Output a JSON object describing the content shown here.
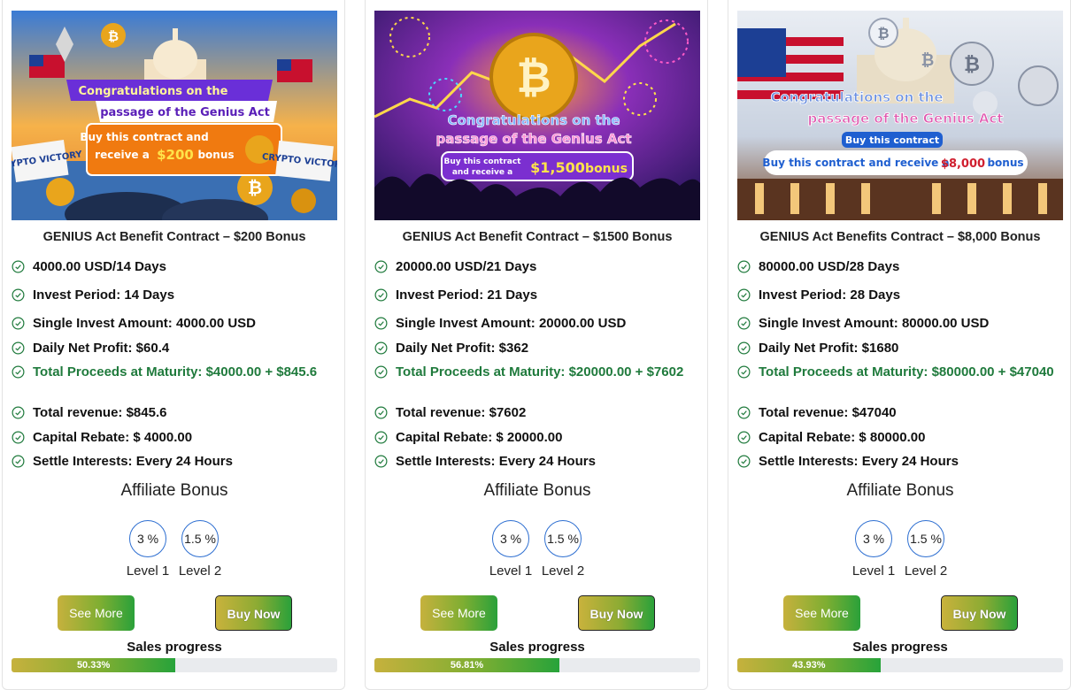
{
  "contracts": [
    {
      "banner": {
        "headline_1": "Congratulations on the",
        "headline_2": "passage  of the Genius Act",
        "offer_1": "Buy this contract and",
        "offer_2": "receive a",
        "bonus": "$200",
        "bonus_word": "bonus",
        "sign_left": "CRYPTO VICTORY",
        "sign_right": "CRYPTO VICTORY",
        "colors": {
          "sky": "#f6b24a",
          "headline_bg": "#6a2fd8",
          "offer_bg": "#f07a10"
        }
      },
      "title": "GENIUS Act Benefit Contract – $200 Bonus",
      "features": [
        "4000.00 USD/14 Days",
        "Invest Period: 14 Days",
        "Single Invest Amount: 4000.00 USD",
        "Daily Net Profit: $60.4",
        "Total Proceeds at Maturity: $4000.00 + $845.6",
        "Total revenue: $845.6",
        "Capital Rebate: $ 4000.00",
        "Settle Interests: Every 24 Hours"
      ],
      "affiliate_title": "Affiliate Bonus",
      "levels": [
        {
          "rate": "3 %",
          "label": "Level 1"
        },
        {
          "rate": "1.5 %",
          "label": "Level 2"
        }
      ],
      "see_more": "See More",
      "buy_now": "Buy Now",
      "sales_label": "Sales progress",
      "progress_text": "50.33%",
      "progress": 50.33
    },
    {
      "banner": {
        "headline_1": "Congratulations on the",
        "headline_2": "passage of the Genius Act",
        "offer_1": "Buy this contract",
        "offer_2": "and receive a",
        "bonus": "$1,500",
        "bonus_word": "bonus",
        "colors": {
          "sky": "#2b1c6b",
          "headline_bg": "#4a2fc4",
          "offer_bg": "#7b2fd0"
        }
      },
      "title": "GENIUS Act Benefit Contract – $1500 Bonus",
      "features": [
        "20000.00 USD/21 Days",
        "Invest Period: 21 Days",
        "Single Invest Amount: 20000.00 USD",
        "Daily Net Profit: $362",
        "Total Proceeds at Maturity: $20000.00 + $7602",
        "Total revenue: $7602",
        "Capital Rebate: $ 20000.00",
        "Settle Interests: Every 24 Hours"
      ],
      "affiliate_title": "Affiliate Bonus",
      "levels": [
        {
          "rate": "3 %",
          "label": "Level 1"
        },
        {
          "rate": "1.5 %",
          "label": "Level 2"
        }
      ],
      "see_more": "See More",
      "buy_now": "Buy Now",
      "sales_label": "Sales progress",
      "progress_text": "56.81%",
      "progress": 56.81
    },
    {
      "banner": {
        "headline_1": "Congratulations on the",
        "headline_2": "passage of the Genius Act",
        "offer_1": "Buy this contract",
        "offer_2": "Buy this contract and receive a",
        "bonus": "$8,000",
        "bonus_word": "bonus",
        "colors": {
          "sky": "#cfd6e2",
          "headline_bg": "#ffffff",
          "offer_bg": "#1f5fd0"
        }
      },
      "title": "GENIUS Act Benefits Contract – $8,000 Bonus",
      "features": [
        "80000.00 USD/28 Days",
        "Invest Period: 28 Days",
        "Single Invest Amount: 80000.00 USD",
        "Daily Net Profit: $1680",
        "Total Proceeds at Maturity: $80000.00 + $47040",
        "Total revenue: $47040",
        "Capital Rebate: $ 80000.00",
        "Settle Interests: Every 24 Hours"
      ],
      "affiliate_title": "Affiliate Bonus",
      "levels": [
        {
          "rate": "3 %",
          "label": "Level 1"
        },
        {
          "rate": "1.5 %",
          "label": "Level 2"
        }
      ],
      "see_more": "See More",
      "buy_now": "Buy Now",
      "sales_label": "Sales progress",
      "progress_text": "43.93%",
      "progress": 43.93
    }
  ],
  "icons": {
    "check": "check-circle-icon",
    "coin": "bitcoin-coin-icon"
  },
  "colors": {
    "check": "#1f7a3c",
    "accent_blue": "#2e6fd1",
    "progress_track": "#e9ebee"
  }
}
